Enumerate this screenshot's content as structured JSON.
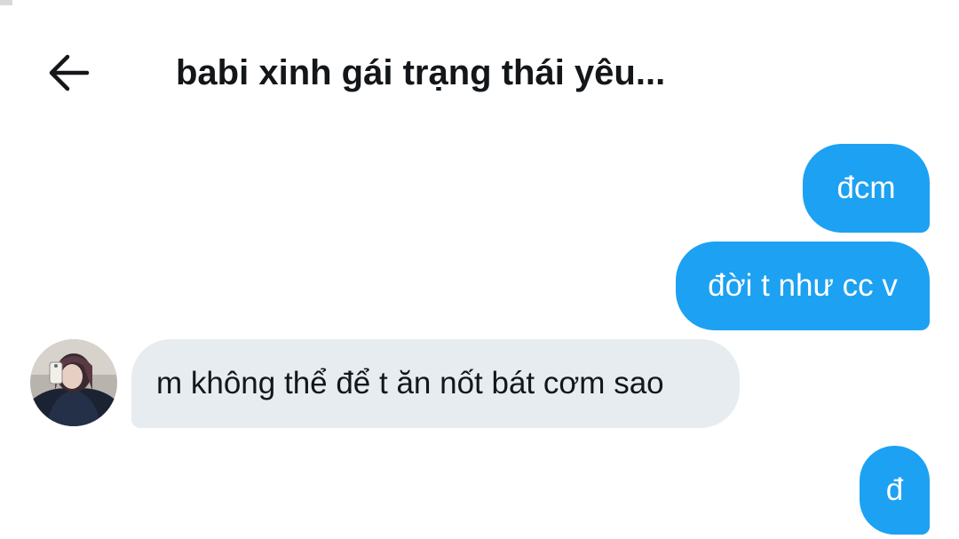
{
  "header": {
    "back_icon": "arrow-left-icon",
    "title": "babi xinh gái trạng thái yêu..."
  },
  "messages": [
    {
      "direction": "sent",
      "text": "đcm"
    },
    {
      "direction": "sent",
      "text": "đời t như cc v"
    },
    {
      "direction": "received",
      "text": "m không thể để t ăn nốt bát cơm sao"
    },
    {
      "direction": "sent",
      "text": "đ"
    }
  ],
  "colors": {
    "sent_bubble": "#1da1f2",
    "received_bubble": "#e6ecf0",
    "text_dark": "#14171a"
  }
}
